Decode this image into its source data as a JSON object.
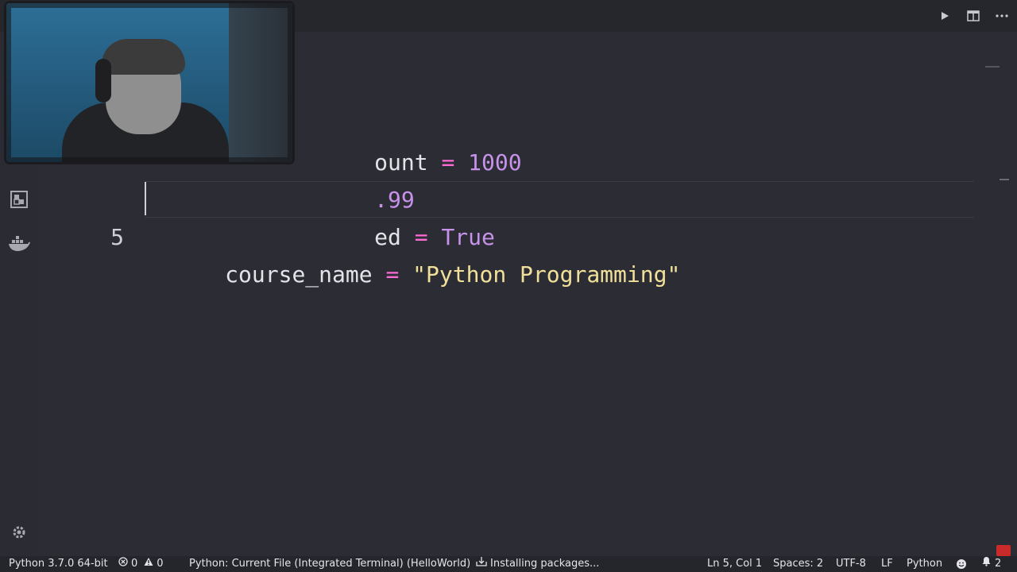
{
  "editor": {
    "lines": [
      {
        "number": "",
        "name": "ount",
        "op": "=",
        "value": "1000",
        "type": "num"
      },
      {
        "number": "",
        "name": "",
        "op": "",
        "value": ".99",
        "type": "num"
      },
      {
        "number": "",
        "name": "ed",
        "op": "=",
        "value": "True",
        "type": "kw"
      },
      {
        "number": "",
        "name": "course_name",
        "op": "=",
        "value": "\"Python Programming\"",
        "type": "str"
      },
      {
        "number": "5",
        "name": "",
        "op": "",
        "value": "",
        "type": "empty"
      }
    ]
  },
  "icons": {
    "run": "play-icon",
    "split": "split-editor-icon",
    "more": "more-actions-icon",
    "extensions": "extensions-icon",
    "docker": "docker-icon",
    "settings": "gear-icon",
    "errors": "error-icon",
    "warnings": "warning-icon",
    "download": "download-icon",
    "feedback": "smiley-icon",
    "notifications": "bell-icon"
  },
  "statusbar": {
    "interpreter": "Python 3.7.0 64-bit",
    "errors": "0",
    "warnings": "0",
    "debug_config": "Python: Current File (Integrated Terminal) (HelloWorld)",
    "task": "Installing packages...",
    "cursor_pos": "Ln 5, Col 1",
    "spaces": "Spaces: 2",
    "encoding": "UTF-8",
    "eol": "LF",
    "language": "Python",
    "notifications_count": "2"
  },
  "colors": {
    "background": "#2b2b33",
    "operator": "#ff6ad5",
    "number": "#c792ea",
    "string": "#f1e09a"
  }
}
